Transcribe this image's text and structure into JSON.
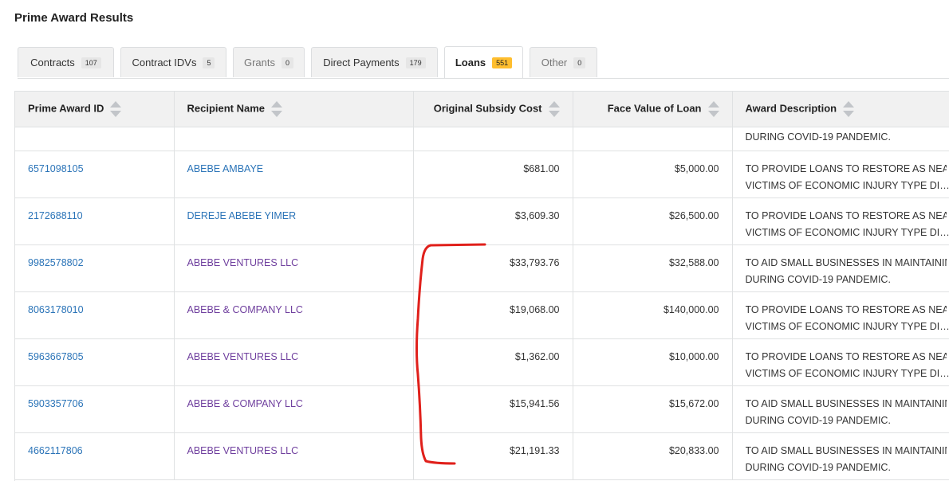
{
  "page": {
    "title": "Prime Award Results"
  },
  "tabs": [
    {
      "label": "Contracts",
      "count": "107",
      "state": "normal"
    },
    {
      "label": "Contract IDVs",
      "count": "5",
      "state": "normal"
    },
    {
      "label": "Grants",
      "count": "0",
      "state": "disabled"
    },
    {
      "label": "Direct Payments",
      "count": "179",
      "state": "normal"
    },
    {
      "label": "Loans",
      "count": "551",
      "state": "active"
    },
    {
      "label": "Other",
      "count": "0",
      "state": "disabled"
    }
  ],
  "table": {
    "columns": [
      "Prime Award ID",
      "Recipient Name",
      "Original Subsidy Cost",
      "Face Value of Loan",
      "Award Description"
    ],
    "partial_row": {
      "desc_line2": "DURING COVID-19 PANDEMIC."
    },
    "rows": [
      {
        "id": "6571098105",
        "recipient": "ABEBE AMBAYE",
        "recipient_style": "blue",
        "subsidy": "$681.00",
        "face": "$5,000.00",
        "desc1": "TO PROVIDE LOANS TO RESTORE AS NEARLY",
        "desc2": "VICTIMS OF ECONOMIC INJURY TYPE DISASTERS"
      },
      {
        "id": "2172688110",
        "recipient": "DEREJE ABEBE YIMER",
        "recipient_style": "blue",
        "subsidy": "$3,609.30",
        "face": "$26,500.00",
        "desc1": "TO PROVIDE LOANS TO RESTORE AS NEARLY",
        "desc2": "VICTIMS OF ECONOMIC INJURY TYPE DISASTERS"
      },
      {
        "id": "9982578802",
        "recipient": "ABEBE VENTURES LLC",
        "recipient_style": "purple",
        "subsidy": "$33,793.76",
        "face": "$32,588.00",
        "desc1": "TO AID SMALL BUSINESSES IN MAINTAINING",
        "desc2": "DURING COVID-19 PANDEMIC."
      },
      {
        "id": "8063178010",
        "recipient": "ABEBE & COMPANY LLC",
        "recipient_style": "purple",
        "subsidy": "$19,068.00",
        "face": "$140,000.00",
        "desc1": "TO PROVIDE LOANS TO RESTORE AS NEARLY",
        "desc2": "VICTIMS OF ECONOMIC INJURY TYPE DISASTERS"
      },
      {
        "id": "5963667805",
        "recipient": "ABEBE VENTURES LLC",
        "recipient_style": "purple",
        "subsidy": "$1,362.00",
        "face": "$10,000.00",
        "desc1": "TO PROVIDE LOANS TO RESTORE AS NEARLY",
        "desc2": "VICTIMS OF ECONOMIC INJURY TYPE DISASTERS"
      },
      {
        "id": "5903357706",
        "recipient": "ABEBE & COMPANY LLC",
        "recipient_style": "purple",
        "subsidy": "$15,941.56",
        "face": "$15,672.00",
        "desc1": "TO AID SMALL BUSINESSES IN MAINTAINING",
        "desc2": "DURING COVID-19 PANDEMIC."
      },
      {
        "id": "4662117806",
        "recipient": "ABEBE VENTURES LLC",
        "recipient_style": "purple",
        "subsidy": "$21,191.33",
        "face": "$20,833.00",
        "desc1": "TO AID SMALL BUSINESSES IN MAINTAINING",
        "desc2": "DURING COVID-19 PANDEMIC."
      }
    ]
  },
  "colors": {
    "link_blue": "#2b74b8",
    "link_visited_purple": "#6f3f9e",
    "active_badge": "#ffbe2e",
    "annotation_red": "#e0201b"
  }
}
